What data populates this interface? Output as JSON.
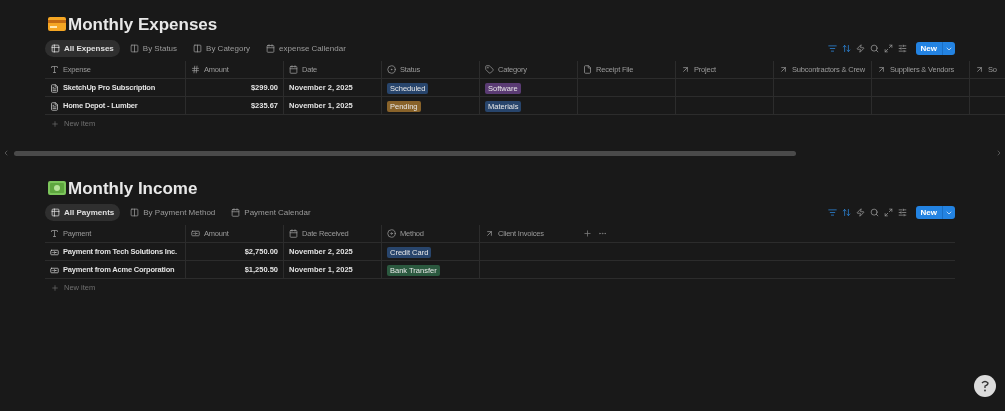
{
  "sections": [
    {
      "kind": "expenses",
      "title": "Monthly Expenses",
      "tabs": [
        {
          "label": "All Expenses",
          "kind": "table",
          "selected": true
        },
        {
          "label": "By Status",
          "kind": "board",
          "selected": false
        },
        {
          "label": "By Category",
          "kind": "board",
          "selected": false
        },
        {
          "label": "expense Callendar",
          "kind": "calendar",
          "selected": false
        }
      ],
      "toolbar": [
        {
          "kind": "filter",
          "active": true
        },
        {
          "kind": "sort",
          "active": true
        },
        {
          "kind": "automation",
          "active": false
        },
        {
          "kind": "search",
          "active": false
        },
        {
          "kind": "expand",
          "active": false
        },
        {
          "kind": "settings",
          "active": false
        }
      ],
      "new_button": "New",
      "columns": [
        {
          "label": "Expense",
          "kind": "title"
        },
        {
          "label": "Amount",
          "kind": "number"
        },
        {
          "label": "Date",
          "kind": "date"
        },
        {
          "label": "Status",
          "kind": "status"
        },
        {
          "label": "Category",
          "kind": "tag"
        },
        {
          "label": "Receipt File",
          "kind": "file"
        },
        {
          "label": "Project",
          "kind": "relation"
        },
        {
          "label": "Subcontractors & Crew",
          "kind": "relation"
        },
        {
          "label": "Suppliers & Vendors",
          "kind": "relation"
        },
        {
          "label": "So",
          "kind": "relation"
        }
      ],
      "rows": [
        {
          "cells": [
            {
              "kind": "title",
              "text": "SketchUp Pro Subscription"
            },
            {
              "kind": "number",
              "text": "$299.00"
            },
            {
              "kind": "text",
              "text": "November 2, 2025"
            },
            {
              "kind": "tag",
              "text": "Scheduled",
              "color": "#28456c"
            },
            {
              "kind": "tag",
              "text": "Software",
              "color": "#5a3b73"
            },
            {
              "kind": "empty"
            },
            {
              "kind": "empty"
            },
            {
              "kind": "empty"
            },
            {
              "kind": "empty"
            },
            {
              "kind": "empty"
            }
          ]
        },
        {
          "cells": [
            {
              "kind": "title",
              "text": "Home Depot - Lumber"
            },
            {
              "kind": "number",
              "text": "$235.67"
            },
            {
              "kind": "text",
              "text": "November 1, 2025"
            },
            {
              "kind": "tag",
              "text": "Pending",
              "color": "#89632a"
            },
            {
              "kind": "tag",
              "text": "Materials",
              "color": "#28456c"
            },
            {
              "kind": "empty"
            },
            {
              "kind": "empty"
            },
            {
              "kind": "empty"
            },
            {
              "kind": "empty"
            },
            {
              "kind": "empty"
            }
          ]
        }
      ],
      "new_item": "New item"
    },
    {
      "kind": "income",
      "title": "Monthly Income",
      "tabs": [
        {
          "label": "All Payments",
          "kind": "table",
          "selected": true
        },
        {
          "label": "By Payment Method",
          "kind": "board",
          "selected": false
        },
        {
          "label": "Payment Calendar",
          "kind": "calendar",
          "selected": false
        }
      ],
      "toolbar": [
        {
          "kind": "filter",
          "active": true
        },
        {
          "kind": "sort",
          "active": true
        },
        {
          "kind": "automation",
          "active": false
        },
        {
          "kind": "search",
          "active": false
        },
        {
          "kind": "expand",
          "active": false
        },
        {
          "kind": "settings",
          "active": false
        }
      ],
      "new_button": "New",
      "columns": [
        {
          "label": "Payment",
          "kind": "title"
        },
        {
          "label": "Amount",
          "kind": "money"
        },
        {
          "label": "Date Received",
          "kind": "date"
        },
        {
          "label": "Method",
          "kind": "select"
        },
        {
          "label": "Client Invoices",
          "kind": "relation"
        }
      ],
      "rows": [
        {
          "cells": [
            {
              "kind": "title",
              "text": "Payment from Tech Solutions Inc."
            },
            {
              "kind": "number",
              "text": "$2,750.00"
            },
            {
              "kind": "text",
              "text": "November 2, 2025"
            },
            {
              "kind": "tag",
              "text": "Credit Card",
              "color": "#28456c"
            },
            {
              "kind": "empty"
            }
          ]
        },
        {
          "cells": [
            {
              "kind": "title",
              "text": "Payment from Acme Corporation"
            },
            {
              "kind": "number",
              "text": "$1,250.50"
            },
            {
              "kind": "text",
              "text": "November 1, 2025"
            },
            {
              "kind": "tag",
              "text": "Bank Transfer",
              "color": "#2b593f"
            },
            {
              "kind": "empty"
            }
          ]
        }
      ],
      "new_item": "New item"
    }
  ]
}
